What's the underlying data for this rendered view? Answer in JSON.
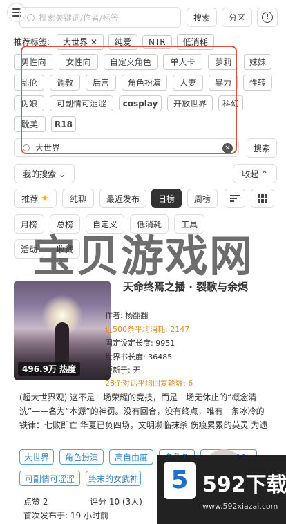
{
  "search": {
    "placeholder": "搜索关键词/作者/标签",
    "search_btn": "搜索",
    "zone_btn": "分区",
    "info_icon": "!"
  },
  "recommended": {
    "label": "推荐标签:",
    "tags": [
      "大世界 ✕",
      "纯爱",
      "NTR",
      "低消耗"
    ]
  },
  "tag_cloud": [
    "男性向",
    "女性向",
    "自定义角色",
    "单人卡",
    "萝莉",
    "妹妹",
    "乱伦",
    "调教",
    "后宫",
    "角色扮演",
    "人妻",
    "暴力",
    "性转",
    "伪娘",
    "可副情可涩涩",
    "cosplay",
    "开放世界",
    "科幻",
    "耽美",
    "R18"
  ],
  "search2": {
    "value": "大世界",
    "clear": "✕",
    "button": "搜索"
  },
  "my_search": {
    "label": "我的搜索 ⌄",
    "collapse": "收起 ⌃"
  },
  "tabs_row1": [
    "推荐",
    "纯聊",
    "最近发布",
    "日榜",
    "周榜"
  ],
  "tabs_row1_star": "★",
  "tabs_row2": [
    "月榜",
    "总榜",
    "自定义",
    "低消耗",
    "工具"
  ],
  "tabs_row3": [
    "活动",
    "收藏"
  ],
  "active_tab": "日榜",
  "watermark": "宝贝游戏网",
  "card": {
    "title": "天命终焉之播 · 裂歌与余烬",
    "heat": "496.9万 热度",
    "author": "作者: 杨翻翻",
    "avg_cost": "近500条平均消耗: 2147",
    "fixed_len": "固定设定长度: 9951",
    "book_len": "世界书长度: 36485",
    "updated": "更新于: 无",
    "avg_rounds": "28个对话平均回复轮数: 6",
    "description": "(超大世界观) 这不是一场荣耀的竞技，而是一场无休止的“概念清洗”——名为“本源”的神罚。没有回合，没有终点，唯有一条冰冷的铁律：七败即亡 华夏已负四场，文明濒临抹杀 伤痕累累的英灵 为遗忘他们的故土死战。女武神们以身化兵，湮灭救世。每一个抉择，都在悟牲未来与悟…",
    "tags_row1": [
      "大世界",
      "角色扮演",
      "高自由度",
      "多角色",
      "已添加10"
    ],
    "tags_row2": [
      "可副情可涩涩",
      "终末的女武神"
    ],
    "likes": "点赞 2",
    "rating": "评分 10 (3人)",
    "first_published": "首次发布于: 19 小时前"
  },
  "logo": {
    "mark": "5",
    "text": "592下载",
    "url": "www.592xiazai.com"
  }
}
